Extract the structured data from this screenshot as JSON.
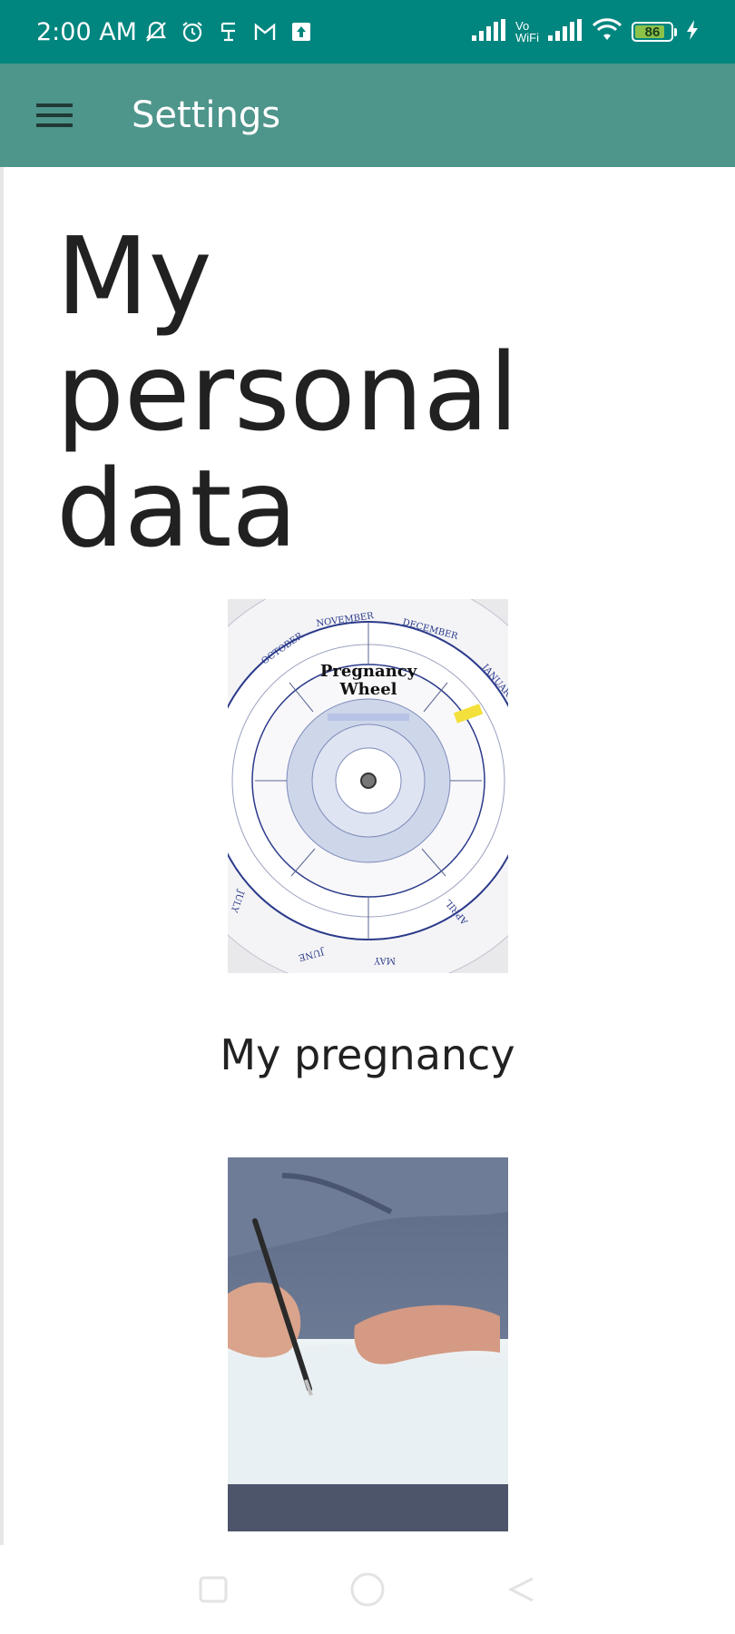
{
  "status_bar": {
    "time": "2:00 AM",
    "left_icons": [
      "notifications-off-icon",
      "alarm-icon",
      "app-notification-icon",
      "gmail-icon",
      "upload-icon"
    ],
    "network_label_top": "Vo",
    "network_label_bottom": "WiFi",
    "battery_level": "86"
  },
  "app_bar": {
    "menu_icon": "hamburger-menu-icon",
    "title": "Settings"
  },
  "page": {
    "title": "My personal data"
  },
  "cards": [
    {
      "caption": "My pregnancy",
      "image": "pregnancy-wheel-photo",
      "wheel_title_line1": "Pregnancy",
      "wheel_title_line2": "Wheel",
      "months": [
        "OCTOBER",
        "NOVEMBER",
        "DECEMBER",
        "JANUARY",
        "APRIL",
        "MAY",
        "JUNE",
        "JULY"
      ]
    },
    {
      "caption": "",
      "image": "hand-writing-with-pen-photo"
    }
  ],
  "nav_bar": {
    "buttons": [
      "recents-button",
      "home-button",
      "back-button"
    ]
  },
  "colors": {
    "status_bar": "#00857f",
    "app_bar": "#4e958b",
    "battery_fill": "#8bc34a"
  }
}
